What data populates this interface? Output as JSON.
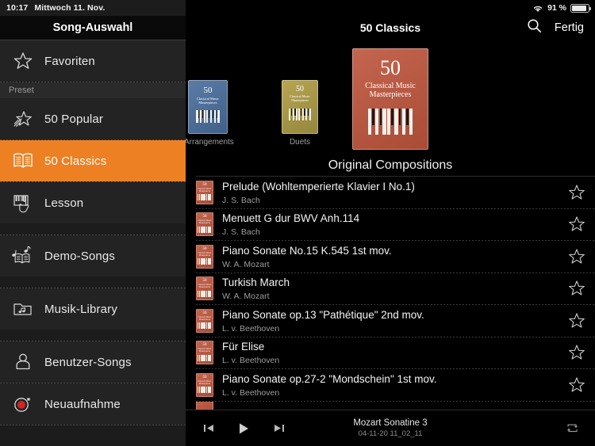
{
  "status_bar": {
    "time": "10:17",
    "date": "Mittwoch 11. Nov.",
    "wifi_icon": "wifi-icon",
    "battery_percent": "91 %",
    "battery_icon": "battery-icon",
    "battery_level": 91
  },
  "sidebar": {
    "title": "Song-Auswahl",
    "preset_header": "Preset",
    "items": [
      {
        "label": "Favoriten",
        "icon": "star-outline-icon",
        "selected": false
      },
      {
        "label": "50 Popular",
        "icon": "shooting-star-icon",
        "selected": false
      },
      {
        "label": "50 Classics",
        "icon": "open-book-icon",
        "selected": true
      },
      {
        "label": "Lesson",
        "icon": "piano-hand-icon",
        "selected": false
      },
      {
        "label": "Demo-Songs",
        "icon": "music-book-icon",
        "selected": false
      },
      {
        "label": "Musik-Library",
        "icon": "music-folder-icon",
        "selected": false
      },
      {
        "label": "Benutzer-Songs",
        "icon": "person-icon",
        "selected": false
      },
      {
        "label": "Neuaufnahme",
        "icon": "record-icon",
        "selected": false
      }
    ],
    "accent_color": "#ed8023"
  },
  "main": {
    "nav": {
      "title": "50 Classics",
      "search_icon": "search-icon",
      "done_label": "Fertig"
    },
    "carousel": {
      "caption": "Original Compositions",
      "covers": [
        {
          "caption": "Arrangements",
          "color": "#4f76a3",
          "line1": "50",
          "line2": "Classical Music",
          "line3": "Masterpieces"
        },
        {
          "caption": "Duets",
          "color": "#a89645",
          "line1": "50",
          "line2": "Classical Music",
          "line3": "Masterpieces"
        },
        {
          "caption": "",
          "color": "#b5573f",
          "line1": "50",
          "line2": "Classical Music",
          "line3": "Masterpieces"
        }
      ]
    },
    "songs": [
      {
        "title": "Prelude (Wohltemperierte Klavier I No.1)",
        "artist": "J. S. Bach",
        "favorite": false,
        "fav_icon": "star-outline-icon"
      },
      {
        "title": "Menuett G dur BWV Anh.114",
        "artist": "J. S. Bach",
        "favorite": false,
        "fav_icon": "star-outline-icon"
      },
      {
        "title": "Piano Sonate No.15 K.545 1st mov.",
        "artist": "W. A. Mozart",
        "favorite": false,
        "fav_icon": "star-outline-icon"
      },
      {
        "title": "Turkish March",
        "artist": "W. A. Mozart",
        "favorite": false,
        "fav_icon": "star-outline-icon"
      },
      {
        "title": "Piano Sonate op.13 \"Pathétique\" 2nd mov.",
        "artist": "L. v. Beethoven",
        "favorite": false,
        "fav_icon": "star-outline-icon"
      },
      {
        "title": "Für Elise",
        "artist": "L. v. Beethoven",
        "favorite": false,
        "fav_icon": "star-outline-icon"
      },
      {
        "title": "Piano Sonate op.27-2 \"Mondschein\" 1st mov.",
        "artist": "L. v. Beethoven",
        "favorite": false,
        "fav_icon": "star-outline-icon"
      }
    ],
    "player": {
      "prev_icon": "previous-track-icon",
      "play_icon": "play-icon",
      "next_icon": "next-track-icon",
      "repeat_icon": "repeat-icon",
      "now_playing_title": "Mozart Sonatine 3",
      "now_playing_subtitle": "04-11-20 11_02_11"
    }
  }
}
